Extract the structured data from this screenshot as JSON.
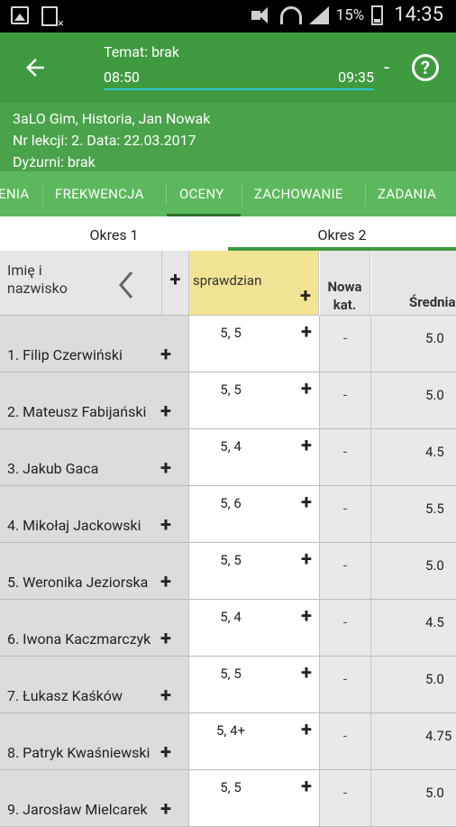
{
  "status_bar": {
    "battery": "15%",
    "time": "14:35"
  },
  "header": {
    "topic": "Temat: brak",
    "start_time": "08:50",
    "end_time": "09:35",
    "dash": "-",
    "help": "?"
  },
  "info": {
    "line1": "3aLO Gim, Historia, Jan Nowak",
    "line2": "Nr lekcji: 2. Data: 22.03.2017",
    "line3": "Dyżurni: brak"
  },
  "tabs": [
    "ENIA",
    "FREKWENCJA",
    "OCENY",
    "ZACHOWANIE",
    "ZADANIA"
  ],
  "active_tab": "OCENY",
  "periods": [
    "Okres 1",
    "Okres 2"
  ],
  "active_period": "Okres 2",
  "table": {
    "name_header": "Imię i nazwisko",
    "add_column": "+",
    "grade_column": "sprawdzian",
    "new_category": "Nowa kat.",
    "average_header": "Średnia",
    "rows": [
      {
        "name": "1. Filip Czerwiński",
        "grades": "5, 5",
        "nowa": "-",
        "avg": "5.0"
      },
      {
        "name": "2. Mateusz Fabijański",
        "grades": "5, 5",
        "nowa": "-",
        "avg": "5.0"
      },
      {
        "name": "3. Jakub Gaca",
        "grades": "5, 4",
        "nowa": "-",
        "avg": "4.5"
      },
      {
        "name": "4. Mikołaj Jackowski",
        "grades": "5, 6",
        "nowa": "-",
        "avg": "5.5"
      },
      {
        "name": "5. Weronika Jeziorska",
        "grades": "5, 5",
        "nowa": "-",
        "avg": "5.0"
      },
      {
        "name": "6. Iwona Kaczmarczyk",
        "grades": "5, 4",
        "nowa": "-",
        "avg": "4.5"
      },
      {
        "name": "7. Łukasz Kaśków",
        "grades": "5, 5",
        "nowa": "-",
        "avg": "5.0"
      },
      {
        "name": "8. Patryk Kwaśniewski",
        "grades": "5, 4+",
        "nowa": "-",
        "avg": "4.75"
      },
      {
        "name": "9. Jarosław Mielcarek",
        "grades": "5, 5",
        "nowa": "-",
        "avg": "5.0"
      }
    ]
  }
}
